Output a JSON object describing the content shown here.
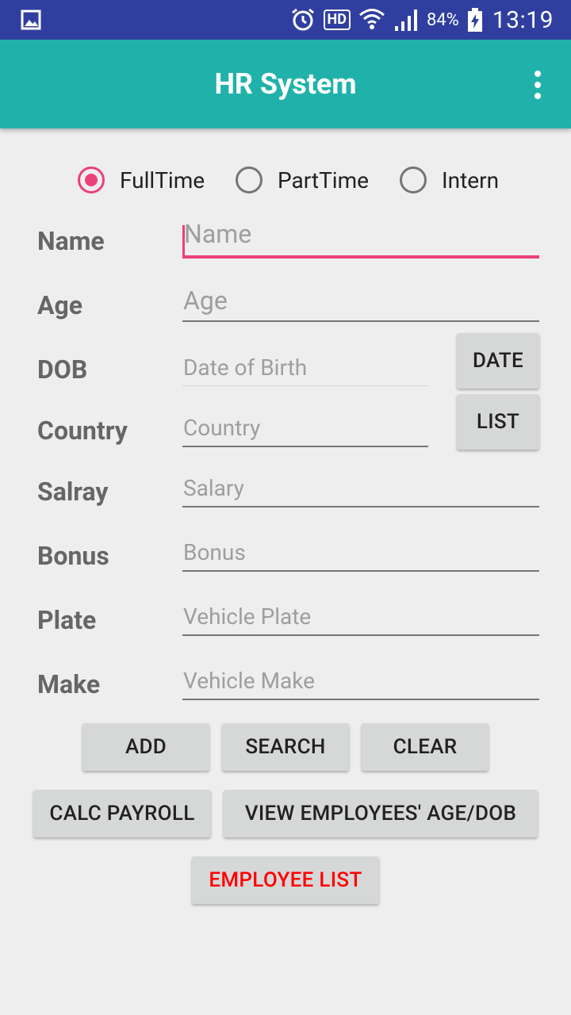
{
  "status_bar": {
    "battery_percent": "84%",
    "clock": "13:19",
    "hd_label": "HD",
    "icons": [
      "gallery-icon",
      "alarm-icon",
      "hd-voice-icon",
      "wifi-icon",
      "signal-icon",
      "battery-charging-icon"
    ]
  },
  "app_bar": {
    "title": "HR System",
    "menu_icon": "overflow-menu-icon",
    "color": "#20b2aa"
  },
  "employee_type": {
    "options": [
      {
        "label": "FullTime",
        "checked": true
      },
      {
        "label": "PartTime",
        "checked": false
      },
      {
        "label": "Intern",
        "checked": false
      }
    ],
    "accent_color": "#ec407a"
  },
  "form": {
    "fields": [
      {
        "label": "Name",
        "placeholder": "Name"
      },
      {
        "label": "Age",
        "placeholder": "Age"
      },
      {
        "label": "DOB",
        "placeholder": "Date of Birth"
      },
      {
        "label": "Country",
        "placeholder": "Country"
      },
      {
        "label": "Salray",
        "placeholder": "Salary"
      },
      {
        "label": "Bonus",
        "placeholder": "Bonus"
      },
      {
        "label": "Plate",
        "placeholder": "Vehicle Plate"
      },
      {
        "label": "Make",
        "placeholder": "Vehicle Make"
      }
    ],
    "date_button": "DATE",
    "list_button": "LIST"
  },
  "actions": {
    "add": "ADD",
    "search": "SEARCH",
    "clear": "CLEAR",
    "calc_payroll": "CALC PAYROLL",
    "view_age_dob": "VIEW EMPLOYEES' AGE/DOB",
    "employee_list": "EMPLOYEE LIST",
    "employee_list_color": "#ff0000"
  }
}
